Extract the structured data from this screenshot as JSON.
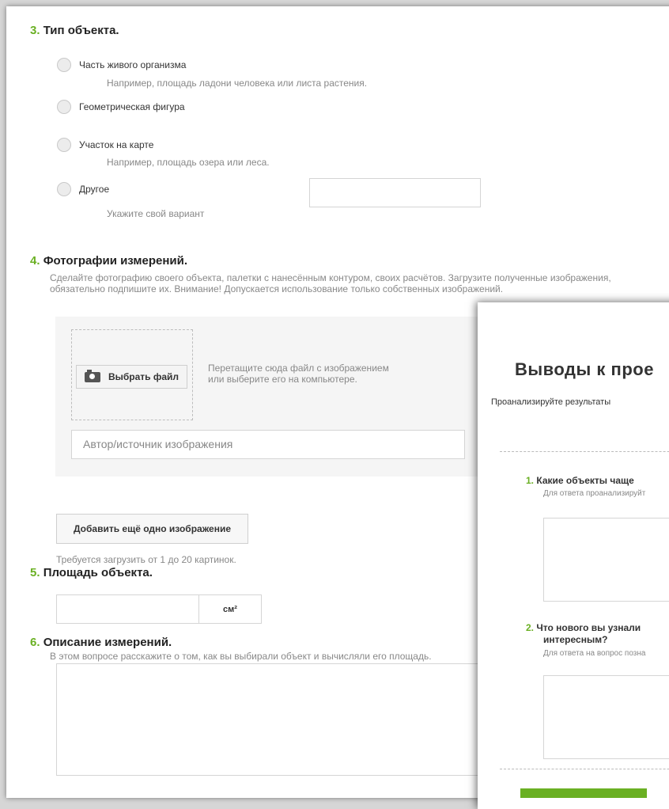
{
  "q3": {
    "num": "3.",
    "title": "Тип объекта.",
    "options": [
      {
        "label": "Часть живого организма",
        "hint": "Например, площадь ладони человека или листа растения."
      },
      {
        "label": "Геометрическая фигура",
        "hint": ""
      },
      {
        "label": "Участок на карте",
        "hint": "Например, площадь озера или леса."
      },
      {
        "label": "Другое",
        "hint": "Укажите свой вариант"
      }
    ]
  },
  "q4": {
    "num": "4.",
    "title": "Фотографии измерений.",
    "desc_line1": "Сделайте фотографию своего объекта, палетки с нанесённым контуром, своих расчётов. Загрузите полученные изображения,",
    "desc_line2": "обязательно подпишите их. Внимание! Допускается использование только собственных изображений.",
    "choose_label": "Выбрать файл",
    "drop_text": "Перетащите сюда файл с изображением или выберите его на компьютере.",
    "author_placeholder": "Автор/источник изображения",
    "add_label": "Добавить ещё одно изображение",
    "requirement": "Требуется загрузить от 1 до 20 картинок."
  },
  "q5": {
    "num": "5.",
    "title": "Площадь объекта.",
    "unit": "см²"
  },
  "q6": {
    "num": "6.",
    "title": "Описание измерений.",
    "desc": "В этом вопросе расскажите о том, как вы выбирали объект и вычисляли его площадь."
  },
  "overlay": {
    "title": "Выводы к прое",
    "intro": "Проанализируйте результаты",
    "q1_num": "1.",
    "q1_title": "Какие объекты чаще",
    "q1_hint": "Для ответа проанализируйт",
    "q2_num": "2.",
    "q2_title_line1": "Что нового вы узнали",
    "q2_title_line2": "интересным?",
    "q2_hint": "Для ответа на вопрос позна"
  },
  "colors": {
    "accent": "#6ab023"
  }
}
